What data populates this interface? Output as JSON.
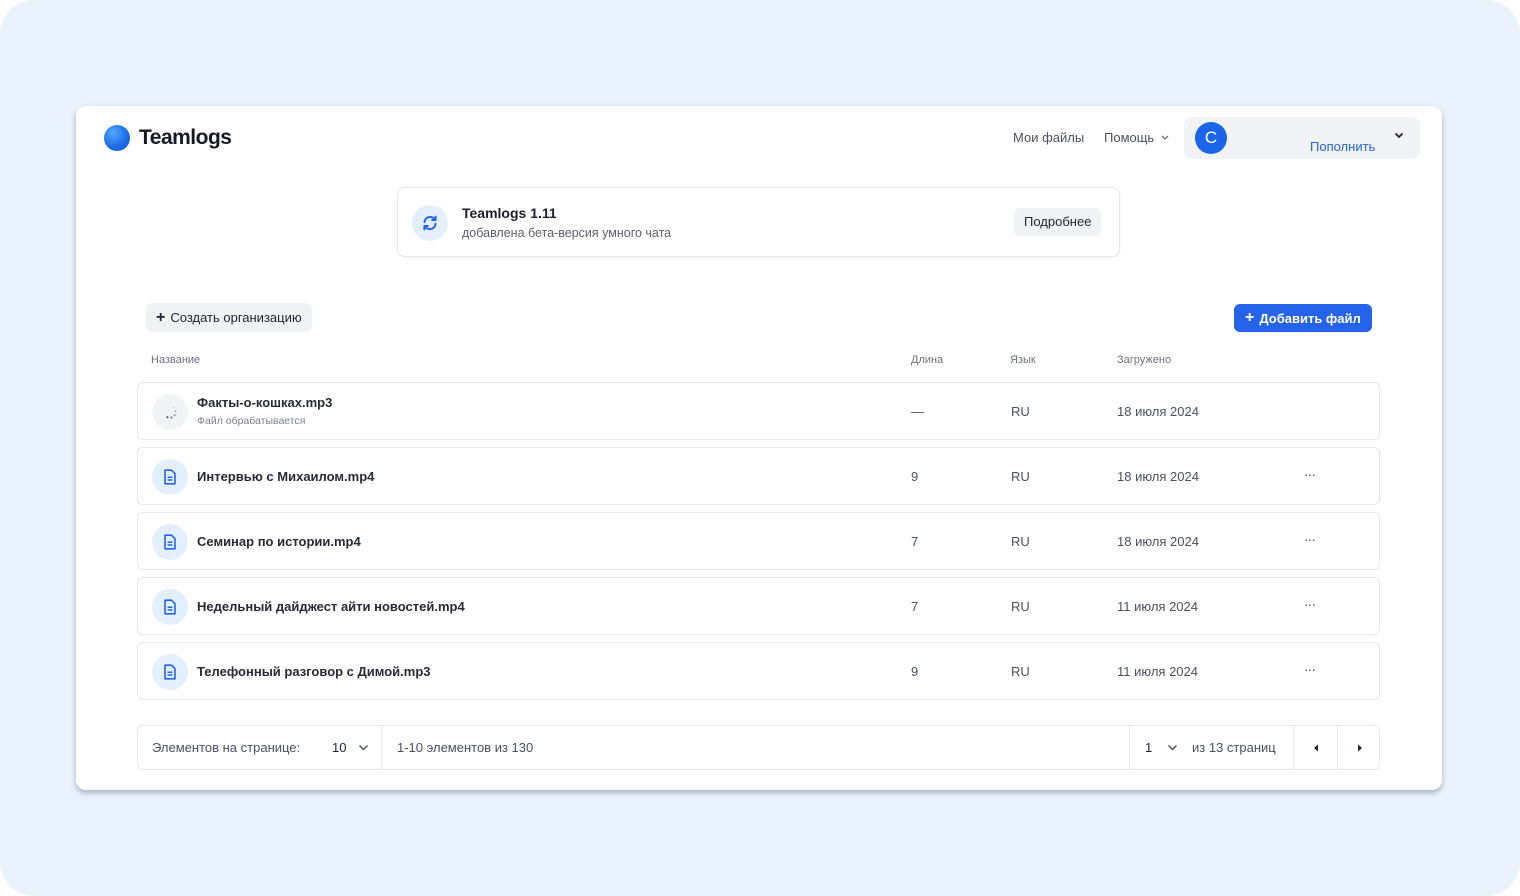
{
  "app": {
    "name": "Teamlogs"
  },
  "nav": {
    "my_files": "Мои файлы",
    "help": "Помощь"
  },
  "account": {
    "avatar_letter": "С",
    "topup": "Пополнить"
  },
  "notice": {
    "title": "Teamlogs 1.11",
    "subtitle": "добавлена бета-версия умного чата",
    "button": "Подробнее"
  },
  "actions": {
    "create_org": "Создать организацию",
    "add_file": "Добавить файл"
  },
  "table": {
    "headers": {
      "name": "Название",
      "length": "Длина",
      "language": "Язык",
      "uploaded": "Загружено"
    },
    "rows": [
      {
        "name": "Факты-о-кошках.mp3",
        "status": "Файл обрабатывается",
        "length": "—",
        "language": "RU",
        "uploaded": "18 июля 2024",
        "icon": "loading-spinner-icon"
      },
      {
        "name": "Интервью с Михаилом.mp4",
        "length": "9",
        "language": "RU",
        "uploaded": "18 июля 2024",
        "icon": "document-icon"
      },
      {
        "name": "Семинар по истории.mp4",
        "length": "7",
        "language": "RU",
        "uploaded": "18 июля 2024",
        "icon": "document-icon"
      },
      {
        "name": "Недельный дайджест айти новостей.mp4",
        "length": "7",
        "language": "RU",
        "uploaded": "11 июля 2024",
        "icon": "document-icon"
      },
      {
        "name": "Телефонный разговор с Димой.mp3",
        "length": "9",
        "language": "RU",
        "uploaded": "11 июля 2024",
        "icon": "document-icon"
      }
    ],
    "row_menu": "···"
  },
  "pagination": {
    "per_page_label": "Элементов на странице:",
    "per_page": "10",
    "range": "1-10 элементов из 130",
    "page": "1",
    "of_pages": "из 13 страниц"
  },
  "colors": {
    "accent": "#2563eb",
    "backdrop": "#eaf2fd",
    "icon_bg": "#e4effd"
  }
}
